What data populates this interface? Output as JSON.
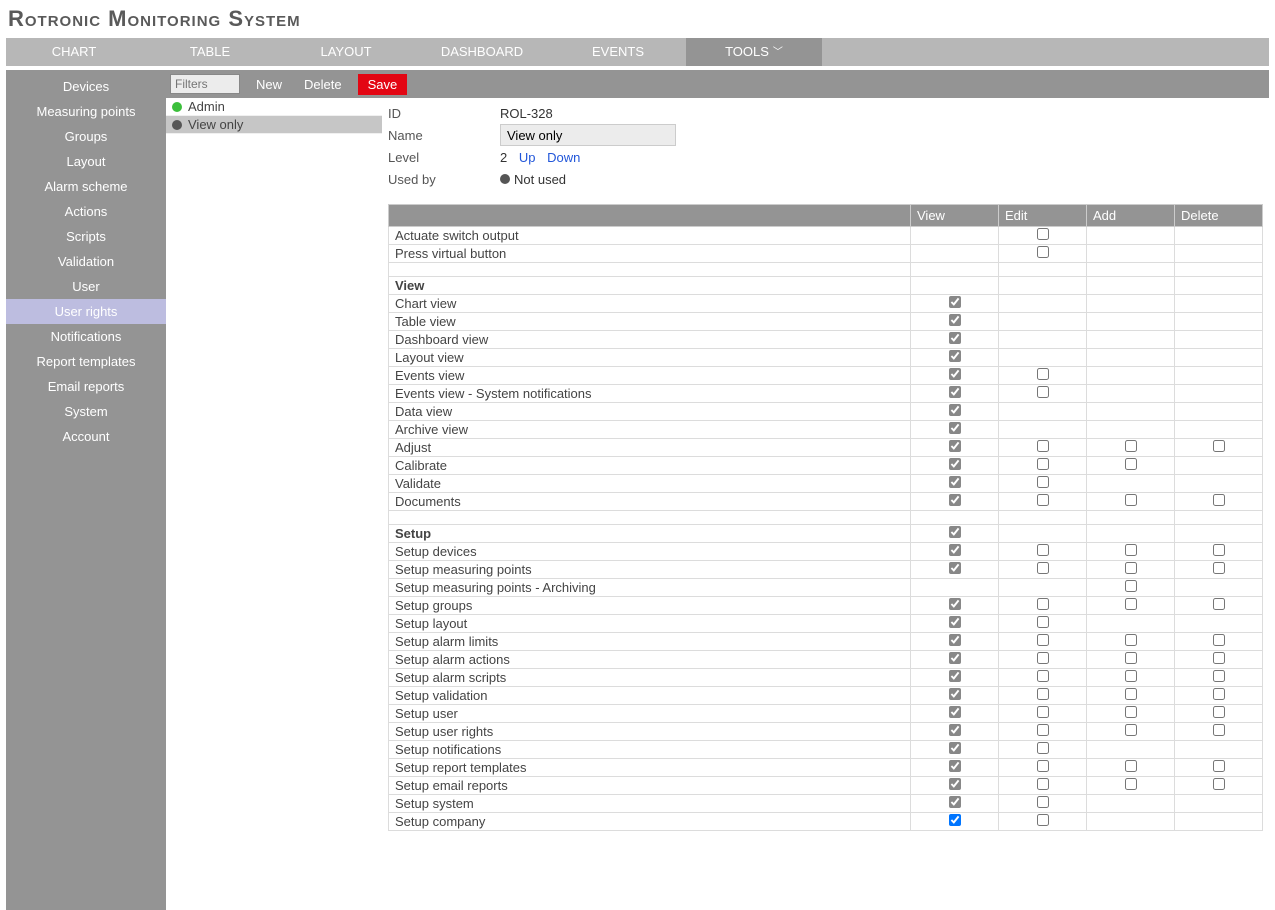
{
  "app_title": "Rotronic Monitoring System",
  "top_nav": [
    {
      "label": "CHART"
    },
    {
      "label": "TABLE"
    },
    {
      "label": "LAYOUT"
    },
    {
      "label": "DASHBOARD"
    },
    {
      "label": "EVENTS"
    },
    {
      "label": "TOOLS",
      "active": true,
      "dropdown": true
    }
  ],
  "sidebar": [
    {
      "label": "Devices"
    },
    {
      "label": "Measuring points"
    },
    {
      "label": "Groups"
    },
    {
      "label": "Layout"
    },
    {
      "label": "Alarm scheme"
    },
    {
      "label": "Actions"
    },
    {
      "label": "Scripts"
    },
    {
      "label": "Validation"
    },
    {
      "label": "User"
    },
    {
      "label": "User rights",
      "selected": true
    },
    {
      "label": "Notifications"
    },
    {
      "label": "Report templates"
    },
    {
      "label": "Email reports"
    },
    {
      "label": "System"
    },
    {
      "label": "Account"
    }
  ],
  "toolbar": {
    "filter_placeholder": "Filters",
    "new_label": "New",
    "delete_label": "Delete",
    "save_label": "Save"
  },
  "roles": [
    {
      "label": "Admin",
      "color": "#3bbf3b"
    },
    {
      "label": "View only",
      "color": "#555",
      "selected": true
    }
  ],
  "detail": {
    "id_label": "ID",
    "id_value": "ROL-328",
    "name_label": "Name",
    "name_value": "View only",
    "level_label": "Level",
    "level_value": "2",
    "up_label": "Up",
    "down_label": "Down",
    "usedby_label": "Used by",
    "usedby_value": "Not used"
  },
  "columns": {
    "view": "View",
    "edit": "Edit",
    "add": "Add",
    "delete": "Delete"
  },
  "rights": [
    {
      "label": "Actuate switch output",
      "view": null,
      "edit": false,
      "add": null,
      "delete": null
    },
    {
      "label": "Press virtual button",
      "view": null,
      "edit": false,
      "add": null,
      "delete": null
    },
    {
      "type": "spacer"
    },
    {
      "type": "section",
      "label": "View"
    },
    {
      "label": "Chart view",
      "view": "locked",
      "edit": null,
      "add": null,
      "delete": null
    },
    {
      "label": "Table view",
      "view": "locked",
      "edit": null,
      "add": null,
      "delete": null
    },
    {
      "label": "Dashboard view",
      "view": "locked",
      "edit": null,
      "add": null,
      "delete": null
    },
    {
      "label": "Layout view",
      "view": "locked",
      "edit": null,
      "add": null,
      "delete": null
    },
    {
      "label": "Events view",
      "view": "locked",
      "edit": false,
      "add": null,
      "delete": null
    },
    {
      "label": "Events view - System notifications",
      "view": "locked",
      "edit": false,
      "add": null,
      "delete": null
    },
    {
      "label": "Data view",
      "view": "locked",
      "edit": null,
      "add": null,
      "delete": null
    },
    {
      "label": "Archive view",
      "view": "locked",
      "edit": null,
      "add": null,
      "delete": null
    },
    {
      "label": "Adjust",
      "view": "locked",
      "edit": false,
      "add": false,
      "delete": false
    },
    {
      "label": "Calibrate",
      "view": "locked",
      "edit": false,
      "add": false,
      "delete": null
    },
    {
      "label": "Validate",
      "view": "locked",
      "edit": false,
      "add": null,
      "delete": null
    },
    {
      "label": "Documents",
      "view": "locked",
      "edit": false,
      "add": false,
      "delete": false
    },
    {
      "type": "spacer"
    },
    {
      "type": "section",
      "label": "Setup",
      "view": "locked"
    },
    {
      "label": "Setup devices",
      "view": "locked",
      "edit": false,
      "add": false,
      "delete": false
    },
    {
      "label": "Setup measuring points",
      "view": "locked",
      "edit": false,
      "add": false,
      "delete": false
    },
    {
      "label": "Setup measuring points - Archiving",
      "view": null,
      "edit": null,
      "add": false,
      "delete": null
    },
    {
      "label": "Setup groups",
      "view": "locked",
      "edit": false,
      "add": false,
      "delete": false
    },
    {
      "label": "Setup layout",
      "view": "locked",
      "edit": false,
      "add": null,
      "delete": null
    },
    {
      "label": "Setup alarm limits",
      "view": "locked",
      "edit": false,
      "add": false,
      "delete": false
    },
    {
      "label": "Setup alarm actions",
      "view": "locked",
      "edit": false,
      "add": false,
      "delete": false
    },
    {
      "label": "Setup alarm scripts",
      "view": "locked",
      "edit": false,
      "add": false,
      "delete": false
    },
    {
      "label": "Setup validation",
      "view": "locked",
      "edit": false,
      "add": false,
      "delete": false
    },
    {
      "label": "Setup user",
      "view": "locked",
      "edit": false,
      "add": false,
      "delete": false
    },
    {
      "label": "Setup user rights",
      "view": "locked",
      "edit": false,
      "add": false,
      "delete": false
    },
    {
      "label": "Setup notifications",
      "view": "locked",
      "edit": false,
      "add": null,
      "delete": null
    },
    {
      "label": "Setup report templates",
      "view": "locked",
      "edit": false,
      "add": false,
      "delete": false
    },
    {
      "label": "Setup email reports",
      "view": "locked",
      "edit": false,
      "add": false,
      "delete": false
    },
    {
      "label": "Setup system",
      "view": "locked",
      "edit": false,
      "add": null,
      "delete": null
    },
    {
      "label": "Setup company",
      "view": true,
      "edit": false,
      "add": null,
      "delete": null
    }
  ]
}
